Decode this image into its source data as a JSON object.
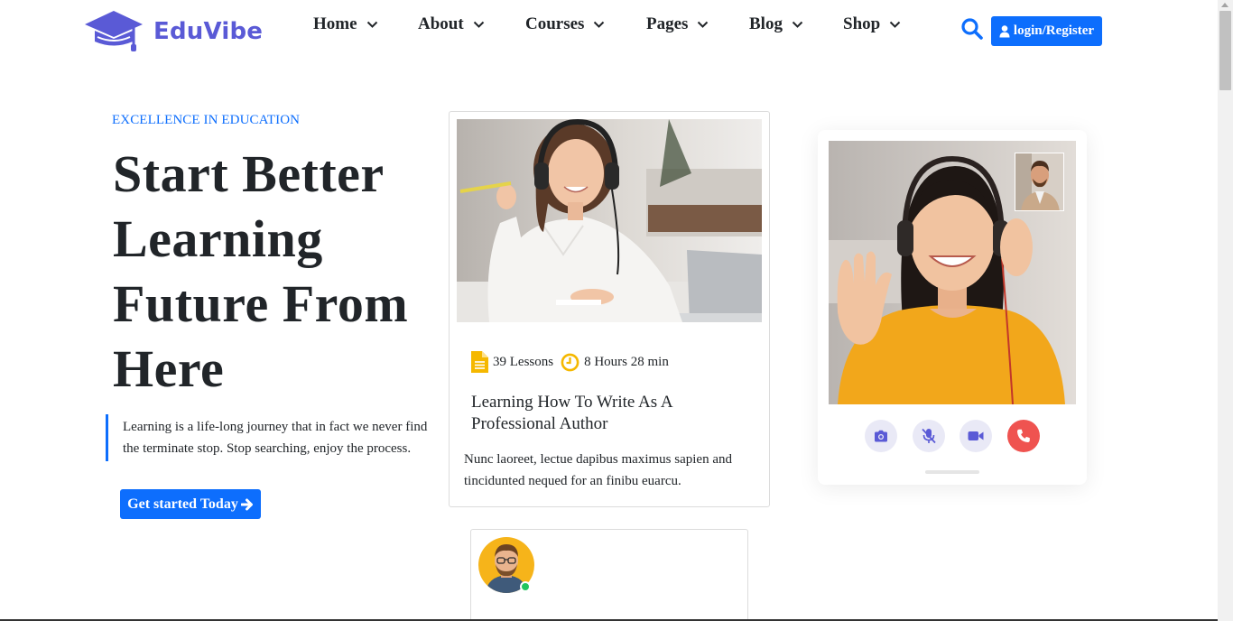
{
  "brand": {
    "name": "EduVibe",
    "icon": "graduation-cap-icon",
    "color": "#5a5ad6"
  },
  "nav": {
    "items": [
      {
        "label": "Home"
      },
      {
        "label": "About"
      },
      {
        "label": "Courses"
      },
      {
        "label": "Pages"
      },
      {
        "label": "Blog"
      },
      {
        "label": "Shop"
      }
    ],
    "dropdown_icon": "chevron-down-icon"
  },
  "header": {
    "search_icon": "search-icon",
    "login_label": "login/Register",
    "login_icon": "user-icon"
  },
  "hero": {
    "eyebrow": "EXCELLENCE IN EDUCATION",
    "title": "Start Better Learning Future From Here",
    "description": "Learning is a life-long journey that in fact we never find the terminate stop. Stop searching, enjoy the process.",
    "cta_label": "Get started Today",
    "cta_icon": "arrow-right-icon"
  },
  "course_card": {
    "lessons": "39 Lessons",
    "duration": "8 Hours 28 min",
    "title": "Learning How To Write As A Professional Author",
    "description": "Nunc laoreet, lectue dapibus maximus sapien and tincidunted nequed for an finibu euarcu."
  },
  "call_card": {
    "controls": [
      "camera-icon",
      "mic-off-icon",
      "video-icon",
      "phone-hangup-icon"
    ],
    "end_call_color": "#ef5350"
  },
  "colors": {
    "accent": "#0d6efd",
    "text": "#212529",
    "lesson_icon": "#f5b800"
  }
}
